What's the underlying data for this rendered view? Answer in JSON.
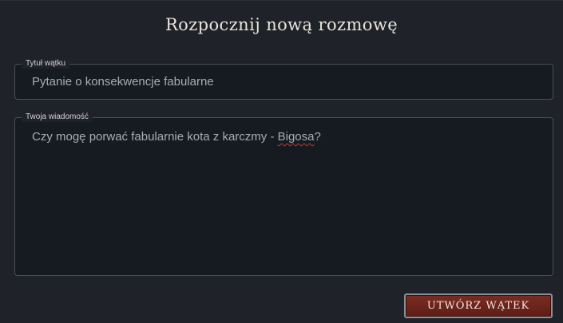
{
  "form": {
    "heading": "Rozpocznij nową rozmowę",
    "thread_title": {
      "label": "Tytuł wątku",
      "value": "Pytanie o konsekwencje fabularne"
    },
    "message": {
      "label": "Twoja wiadomość",
      "value_before_misspelling": "Czy mogę porwać fabularnie kota z karczmy - ",
      "misspelled_word": "Bigosa",
      "value_after_misspelling": "?"
    },
    "submit_label": "UTWÓRZ WĄTEK"
  },
  "colors": {
    "background": "#1f2228",
    "field_background": "#161a21",
    "field_border": "#4a4e57",
    "button": "#6b2419",
    "spellcheck_underline": "#c0392b"
  }
}
